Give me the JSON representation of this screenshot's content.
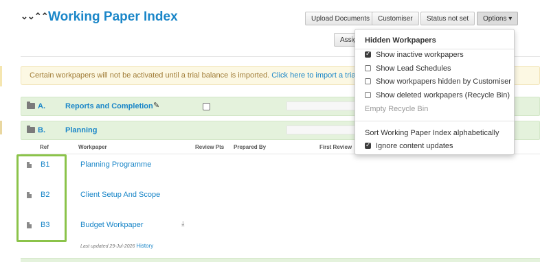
{
  "header": {
    "title": "Working Paper Index",
    "collapse_glyph": "≫",
    "expand_glyph": "≪"
  },
  "toolbar": {
    "upload_label": "Upload Documents",
    "customiser_label": "Customiser",
    "status_label": "Status not set",
    "options_label": "Options ▾",
    "assign_label": "Assig"
  },
  "alert": {
    "text": "Certain workpapers will not be activated until a trial balance is imported.",
    "link": "Click here to import a trial balance"
  },
  "sections": [
    {
      "letter": "A.",
      "name": "Reports and Completion",
      "state": "collapsed"
    },
    {
      "letter": "B.",
      "name": "Planning",
      "state": "expanded"
    }
  ],
  "table": {
    "columns": [
      "Ref",
      "Workpaper",
      "Review Pts",
      "Prepared By",
      "First Review"
    ],
    "rows": [
      {
        "ref": "B1",
        "name": "Planning Programme"
      },
      {
        "ref": "B2",
        "name": "Client Setup And Scope"
      },
      {
        "ref": "B3",
        "name": "Budget Workpaper"
      }
    ],
    "last_updated": "Last updated 29-Jul-2026",
    "history_link": "History"
  },
  "options_menu": {
    "heading": "Hidden Workpapers",
    "items": [
      {
        "label": "Show inactive workpapers",
        "checked": true
      },
      {
        "label": "Show Lead Schedules",
        "checked": false
      },
      {
        "label": "Show workpapers hidden by Customiser",
        "checked": false
      },
      {
        "label": "Show deleted workpapers (Recycle Bin)",
        "checked": false
      }
    ],
    "empty_recycle": "Empty Recycle Bin",
    "sort_label": "Sort Working Paper Index alphabetically",
    "ignore_label": "Ignore content updates",
    "ignore_checked": true
  },
  "colors": {
    "accent": "#1a86c8",
    "section_bg": "#e4f2dc",
    "highlight": "#8bc34a",
    "alert_bg": "#fcf8e3"
  }
}
